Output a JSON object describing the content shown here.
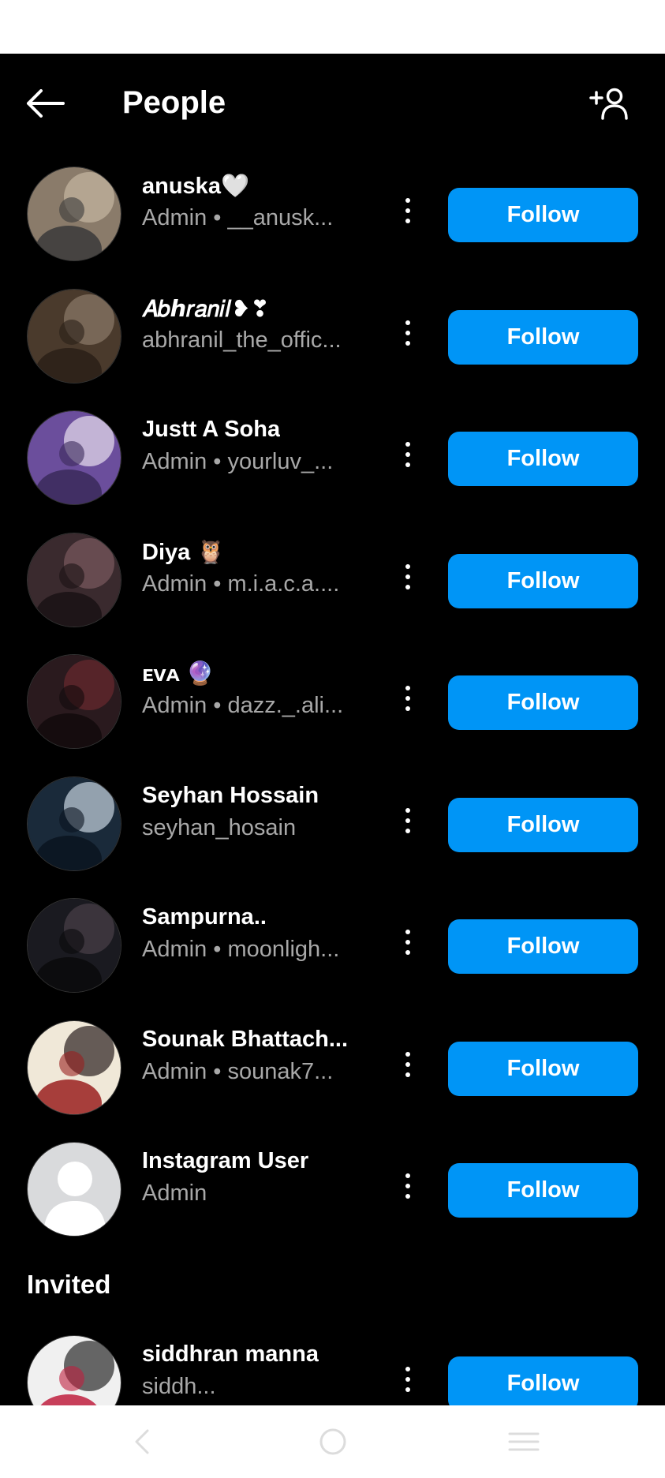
{
  "header": {
    "title": "People"
  },
  "people": [
    {
      "name": "anuska🤍",
      "sub": "Admin • __anusk...",
      "follow": "Follow",
      "avatar_colors": [
        "#8a7b6a",
        "#c6b8a3",
        "#3a3a3a"
      ]
    },
    {
      "name": "𝐴𝑏ℎ𝑟𝑎𝑛𝑖𝑙❥❣",
      "sub": "abhranil_the_offic...",
      "follow": "Follow",
      "avatar_colors": [
        "#4a3a2c",
        "#8c7a6a",
        "#2a2018"
      ]
    },
    {
      "name": "Justt A Soha",
      "sub": "Admin • yourluv_...",
      "follow": "Follow",
      "avatar_colors": [
        "#6b4e9c",
        "#e8e0f0",
        "#3a2a5a"
      ]
    },
    {
      "name": "Diya 🦉",
      "sub": "Admin • m.i.a.c.a....",
      "follow": "Follow",
      "avatar_colors": [
        "#3a2a2e",
        "#7a5a60",
        "#1a1214"
      ]
    },
    {
      "name": "ᴇᴠᴀ 🔮",
      "sub": "Admin • dazz._.ali...",
      "follow": "Follow",
      "avatar_colors": [
        "#2a1a1e",
        "#6a2a2e",
        "#120a0c"
      ]
    },
    {
      "name": "Seyhan Hossain",
      "sub": "seyhan_hosain",
      "follow": "Follow",
      "avatar_colors": [
        "#1a2a3a",
        "#c8d4e0",
        "#0a1420"
      ]
    },
    {
      "name": "Sampurna..",
      "sub": "Admin • moonligh...",
      "follow": "Follow",
      "avatar_colors": [
        "#1a1a20",
        "#4a4048",
        "#0a0a0c"
      ]
    },
    {
      "name": "Sounak Bhattach...",
      "sub": "Admin • sounak7...",
      "follow": "Follow",
      "avatar_colors": [
        "#f0e8d8",
        "#2a2020",
        "#9a2020"
      ]
    },
    {
      "name": "Instagram User",
      "sub": "Admin",
      "follow": "Follow",
      "avatar_colors": [
        "#d9dadc",
        "#ffffff",
        "#d9dadc"
      ]
    }
  ],
  "invited_label": "Invited",
  "invited": [
    {
      "name": "siddhran manna",
      "sub": "siddh...",
      "follow": "Follow",
      "avatar_colors": [
        "#f0f0f0",
        "#2a2a2a",
        "#c02040"
      ]
    }
  ],
  "colors": {
    "accent": "#0095f6",
    "background": "#000000",
    "secondary_text": "#a8a8a8"
  },
  "icons": {
    "back": "arrow-left-icon",
    "add_person": "add-person-icon",
    "more": "more-vertical-icon"
  }
}
